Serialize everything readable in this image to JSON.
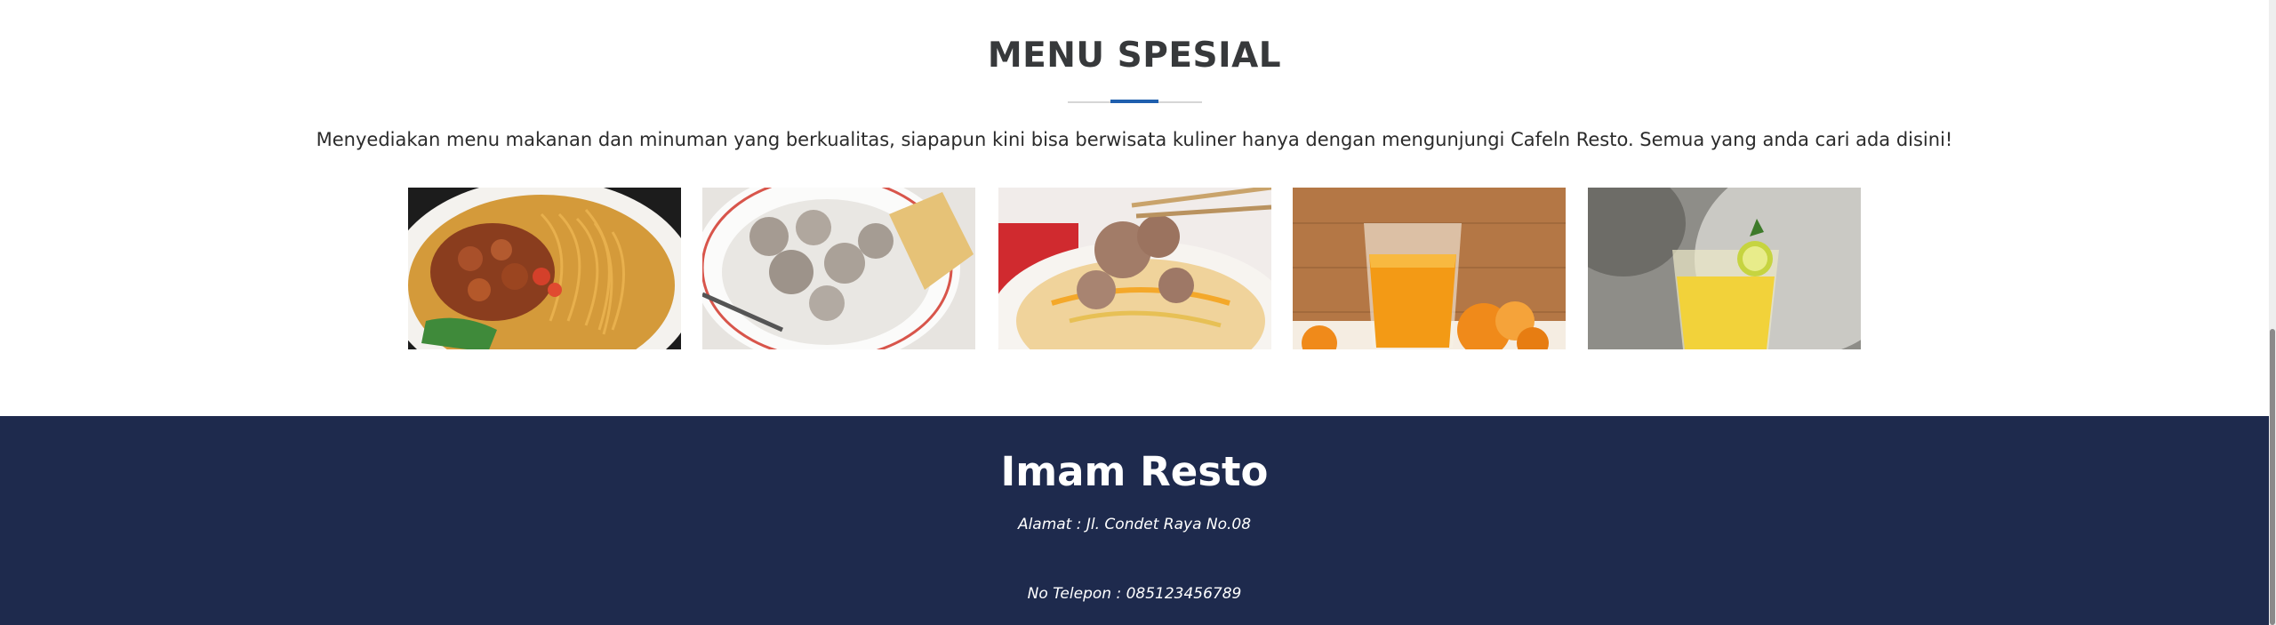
{
  "menu_section": {
    "title": "MENU SPESIAL",
    "description": "Menyediakan menu makanan dan minuman yang berkualitas, siapapun kini bisa berwisata kuliner hanya dengan mengunjungi Cafeln Resto. Semua yang anda cari ada disini!",
    "accent_color": "#1f5fae"
  },
  "carousel": {
    "slides": [
      {
        "icon": "mie-ayam-image"
      },
      {
        "icon": "bakso-image"
      },
      {
        "icon": "bakso-chopsticks-image"
      },
      {
        "icon": "orange-juice-image"
      },
      {
        "icon": "lemon-drink-image"
      }
    ],
    "dot_count": 16,
    "active_dot": 3
  },
  "footer": {
    "title": "Imam Resto",
    "address": "Alamat : Jl. Condet Raya No.08",
    "phone": "No Telepon : 085123456789",
    "background": "#1e2a4d"
  }
}
